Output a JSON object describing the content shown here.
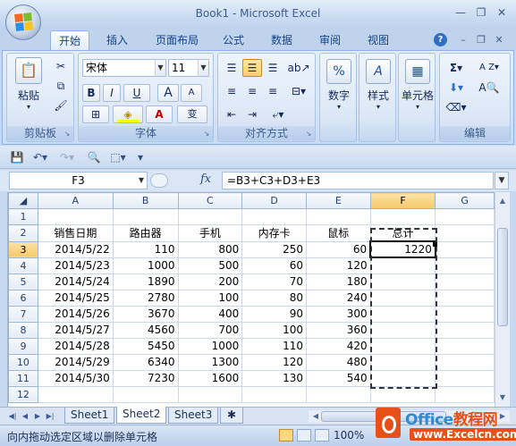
{
  "window": {
    "title": "Book1 - Microsoft Excel",
    "controls": [
      "—",
      "❐",
      "✕"
    ]
  },
  "ribbon_tabs": [
    "开始",
    "插入",
    "页面布局",
    "公式",
    "数据",
    "审阅",
    "视图"
  ],
  "ribbon_right": {
    "help": "?",
    "minimize": "–",
    "restore": "❐",
    "close": "✕"
  },
  "groups": {
    "clipboard": {
      "label": "剪贴板",
      "paste": "粘贴"
    },
    "font": {
      "label": "字体",
      "font_name": "宋体",
      "font_size": "11",
      "bold": "B",
      "italic": "I",
      "underline": "U",
      "grow": "A",
      "shrink": "A",
      "color_a": "A",
      "wen": "变"
    },
    "alignment": {
      "label": "对齐方式"
    },
    "number": {
      "label": "数字",
      "icon": "%"
    },
    "styles": {
      "label": "样式",
      "icon": "A"
    },
    "cells": {
      "label": "单元格"
    },
    "editing": {
      "label": "编辑",
      "sum": "Σ",
      "sort": "A Z",
      "find": "A"
    }
  },
  "formula_bar": {
    "name_box": "F3",
    "fx": "fx",
    "formula": "=B3+C3+D3+E3"
  },
  "columns": [
    "A",
    "B",
    "C",
    "D",
    "E",
    "F",
    "G"
  ],
  "selected_column": "F",
  "selected_row": "3",
  "rows": [
    {
      "n": "1",
      "cells": [
        "",
        "",
        "",
        "",
        "",
        "",
        ""
      ]
    },
    {
      "n": "2",
      "cells": [
        "销售日期",
        "路由器",
        "手机",
        "内存卡",
        "鼠标",
        "总计",
        ""
      ]
    },
    {
      "n": "3",
      "cells": [
        "2014/5/22",
        "110",
        "800",
        "250",
        "60",
        "1220",
        ""
      ]
    },
    {
      "n": "4",
      "cells": [
        "2014/5/23",
        "1000",
        "500",
        "60",
        "120",
        "",
        ""
      ]
    },
    {
      "n": "5",
      "cells": [
        "2014/5/24",
        "1890",
        "200",
        "70",
        "180",
        "",
        ""
      ]
    },
    {
      "n": "6",
      "cells": [
        "2014/5/25",
        "2780",
        "100",
        "80",
        "240",
        "",
        ""
      ]
    },
    {
      "n": "7",
      "cells": [
        "2014/5/26",
        "3670",
        "400",
        "90",
        "300",
        "",
        ""
      ]
    },
    {
      "n": "8",
      "cells": [
        "2014/5/27",
        "4560",
        "700",
        "100",
        "360",
        "",
        ""
      ]
    },
    {
      "n": "9",
      "cells": [
        "2014/5/28",
        "5450",
        "1000",
        "110",
        "420",
        "",
        ""
      ]
    },
    {
      "n": "10",
      "cells": [
        "2014/5/29",
        "6340",
        "1300",
        "120",
        "480",
        "",
        ""
      ]
    },
    {
      "n": "11",
      "cells": [
        "2014/5/30",
        "7230",
        "1600",
        "130",
        "540",
        "",
        ""
      ]
    },
    {
      "n": "12",
      "cells": [
        "",
        "",
        "",
        "",
        "",
        "",
        ""
      ]
    }
  ],
  "sheets": [
    "Sheet1",
    "Sheet2",
    "Sheet3"
  ],
  "active_sheet": "Sheet2",
  "status": {
    "message": "向内拖动选定区域以删除单元格",
    "zoom": "100%"
  },
  "watermark": {
    "line1_a": "Office",
    "line1_b": "教程网",
    "line2": "www.Excelcn.com"
  }
}
